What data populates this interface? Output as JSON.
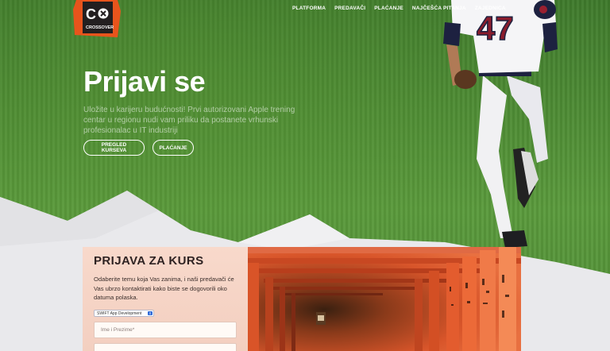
{
  "nav": {
    "items": [
      {
        "label": "PLATFORMA"
      },
      {
        "label": "PREDAVAČI"
      },
      {
        "label": "PLAĆANJE"
      },
      {
        "label": "NAJČEŠĆA PITANJA"
      },
      {
        "label": "ZAJEDNICA"
      }
    ]
  },
  "logo": {
    "mark": "C",
    "sub": "CROSSOVER"
  },
  "hero": {
    "title": "Prijavi se",
    "text": "Uložite u karijeru budućnosti! Prvi autorizovani Apple trening centar u regionu nudi vam priliku da postanete vrhunski profesionalac u IT industriji",
    "buttons": {
      "courses": "PREGLED KURSEVA",
      "pay": "PLAĆANJE"
    },
    "player_number": "47"
  },
  "form": {
    "title": "PRIJAVA ZA KURS",
    "description": "Odaberite temu koja Vas zanima, i naši predavači će Vas ubrzo kontaktirati kako biste se dogovorili oko datuma polaska.",
    "course_selected": "SWIFT App Development",
    "name_placeholder": "Ime i Prezime*",
    "second_placeholder": ""
  },
  "colors": {
    "grass": "#4d8b34",
    "logo_orange": "#e8541c",
    "card_bg": "#f4d9cc",
    "gate_orange": "#e0502a",
    "title_dark": "#2e2222"
  }
}
